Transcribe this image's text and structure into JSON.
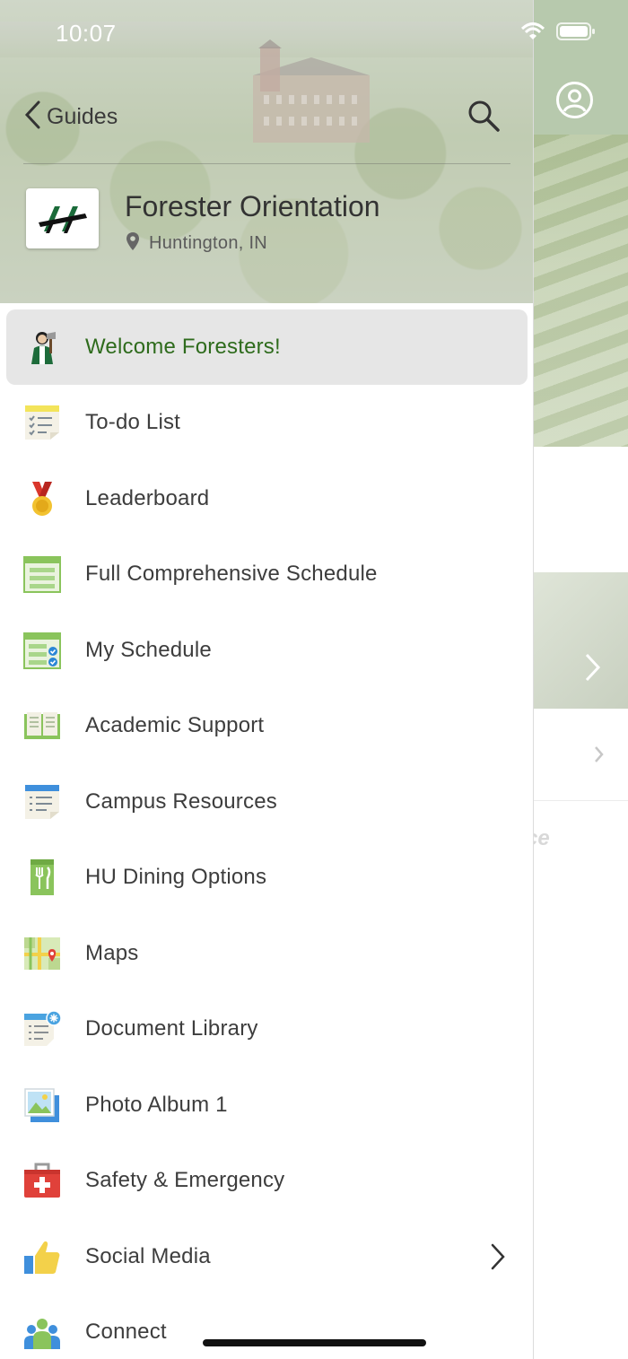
{
  "status_bar": {
    "time": "10:07"
  },
  "header": {
    "back_label": "Guides",
    "guide_title": "Forester Orientation",
    "guide_location": "Huntington, IN"
  },
  "menu": {
    "items": [
      {
        "label": "Welcome Foresters!",
        "icon": "forester-mascot-icon",
        "selected": true
      },
      {
        "label": "To-do List",
        "icon": "todo-list-icon"
      },
      {
        "label": "Leaderboard",
        "icon": "medal-icon"
      },
      {
        "label": "Full Comprehensive Schedule",
        "icon": "schedule-icon"
      },
      {
        "label": "My Schedule",
        "icon": "my-schedule-icon"
      },
      {
        "label": "Academic Support",
        "icon": "book-icon"
      },
      {
        "label": "Campus Resources",
        "icon": "notes-icon"
      },
      {
        "label": "HU Dining Options",
        "icon": "dining-icon"
      },
      {
        "label": "Maps",
        "icon": "map-icon"
      },
      {
        "label": "Document Library",
        "icon": "document-library-icon"
      },
      {
        "label": "Photo Album 1",
        "icon": "photo-album-icon"
      },
      {
        "label": "Safety & Emergency",
        "icon": "first-aid-icon"
      },
      {
        "label": "Social Media",
        "icon": "thumbs-up-icon",
        "has_submenu": true
      },
      {
        "label": "Connect",
        "icon": "people-icon"
      }
    ]
  },
  "background": {
    "partial_text": "ce"
  },
  "colors": {
    "selected_text": "#2e6b1c",
    "selected_bg": "#e6e6e6",
    "text": "#3d3d3d"
  }
}
